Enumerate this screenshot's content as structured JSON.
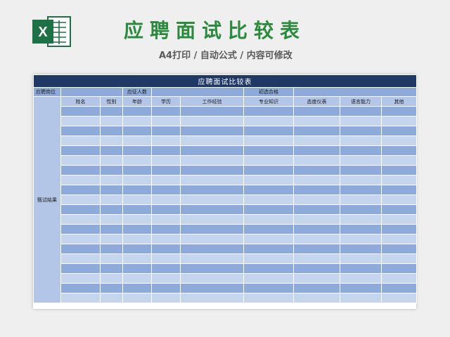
{
  "header": {
    "title": "应聘面试比较表",
    "subtitle": "A4打印 / 自动公式 / 内容可修改"
  },
  "sheet": {
    "heading": "应聘面试比较表",
    "position_label": "应聘岗位",
    "headcount_label": "应征人数",
    "initial_pass_label": "初选合格",
    "result_label": "甄试结果",
    "columns": [
      "姓名",
      "性别",
      "年龄",
      "学历",
      "工作经验",
      "专业知识",
      "态度仪表",
      "语言能力",
      "其他"
    ],
    "empty_rows": 20
  },
  "colors": {
    "title_green": "#2b8a3e",
    "excel_green": "#1e7145",
    "header_navy": "#1f3864",
    "row_dark": "#8eaadb",
    "row_light": "#c5d5ee"
  }
}
